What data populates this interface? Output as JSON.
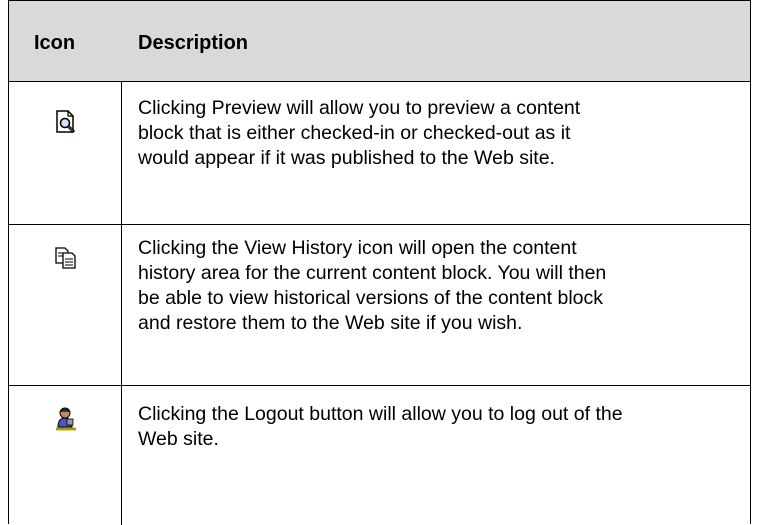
{
  "table": {
    "headers": {
      "icon": "Icon",
      "description": "Description"
    },
    "rows": [
      {
        "icon": "preview-icon",
        "lines": [
          "Clicking Preview will allow you to preview a content",
          "block that is either checked-in or checked-out as it",
          "would appear if it was published to the Web site."
        ]
      },
      {
        "icon": "view-history-icon",
        "lines": [
          "Clicking the View History icon will open the content",
          "history area for the current content block. You will then",
          "be able to view historical versions of the content block",
          "and restore them to the Web site if you wish."
        ]
      },
      {
        "icon": "logout-icon",
        "lines": [
          "Clicking the Logout button will allow you to log out of the",
          "Web site."
        ]
      }
    ]
  },
  "colors": {
    "header_bg": "#d9d9d9",
    "border": "#000000"
  }
}
